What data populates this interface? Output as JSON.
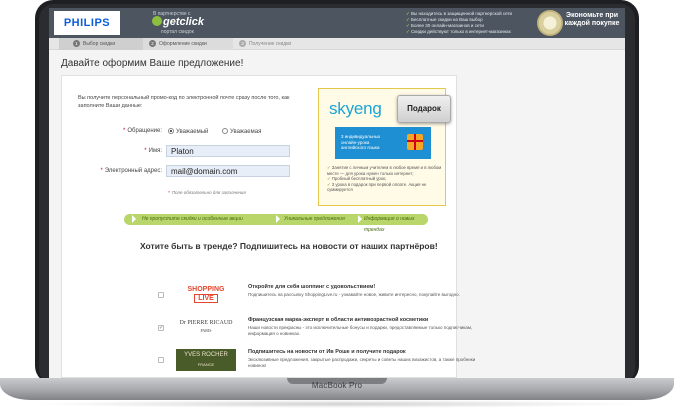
{
  "header": {
    "brand": "PHILIPS",
    "partner_prefix": "В партнерстве с",
    "partner_name": "getclick",
    "partner_sub": "портал скидок",
    "features": [
      "Вы находитесь в защищенной партнерской сети",
      "Бесплатные скидки на Ваш выбор",
      "Более 30 онлайн-магазинов и сети",
      "Скидки действуют только в интернет-магазинах"
    ],
    "economy_text": "Экономьте при каждой покупке"
  },
  "steps": [
    {
      "num": "1",
      "label": "Выбор скидки"
    },
    {
      "num": "2",
      "label": "Оформление скидки"
    },
    {
      "num": "3",
      "label": "Получение скидки"
    }
  ],
  "page_title": "Давайте оформим Ваше предложение!",
  "form": {
    "intro": "Вы получите персональный промо-код по электронной почте сразу после того, как заполните Ваши данные:",
    "salutation_label": "Обращение:",
    "salutation_options": [
      "Уважаемый",
      "Уважаемая"
    ],
    "name_label": "Имя:",
    "name_value": "Platon",
    "email_label": "Электронный адрес:",
    "email_value": "mail@domain.com",
    "hint": "Поле обязательно для заполнения"
  },
  "ad": {
    "brand": "skyeng",
    "gift_button": "Подарок",
    "banner_text": "3 индивидуальных онлайн-урока английского языка",
    "list": [
      "Занятия с личным учителем в любое время и в любом месте — для урока нужен только интернет;",
      "Пробный бесплатный урок;",
      "3 урока в подарок при первой оплате. Акция не суммируется"
    ]
  },
  "ribbon": [
    "Не пропустите скидки и особенные акции",
    "Уникальные предложения",
    "Информация о новых трендах"
  ],
  "subscribe": {
    "title": "Хотите быть в тренде? Подпишитесь на новости от наших партнёров!",
    "items": [
      {
        "logo_line1": "SHOPPING",
        "logo_line2": "LIVE",
        "title": "Откройте для себя шоппинг с удовольствием!",
        "desc": "Подпишитесь на рассылку ShoppingLive.ru - узнавайте новое, живите интересно, покупайте выгодно.",
        "checked": false
      },
      {
        "logo_line1": "Dr PIERRE RICAUD",
        "logo_line2": "PARIS",
        "title": "Французская марка-эксперт в области антивозрастной косметики",
        "desc": "Наши новости прекрасны - это исключительные бонусы и подарки, предоставляемые только подписчикам, информация о новинках.",
        "checked": true
      },
      {
        "logo_line1": "YVES ROCHER",
        "logo_line2": "FRANCE",
        "title": "Подпишитесь на новости от Ив Роше и получите подарок",
        "desc": "Эксклюзивные предложения, закрытые распродажи, секреты и советы наших визажистов, а также пробники новинок!",
        "checked": false
      }
    ]
  },
  "device_label": "MacBook Pro"
}
